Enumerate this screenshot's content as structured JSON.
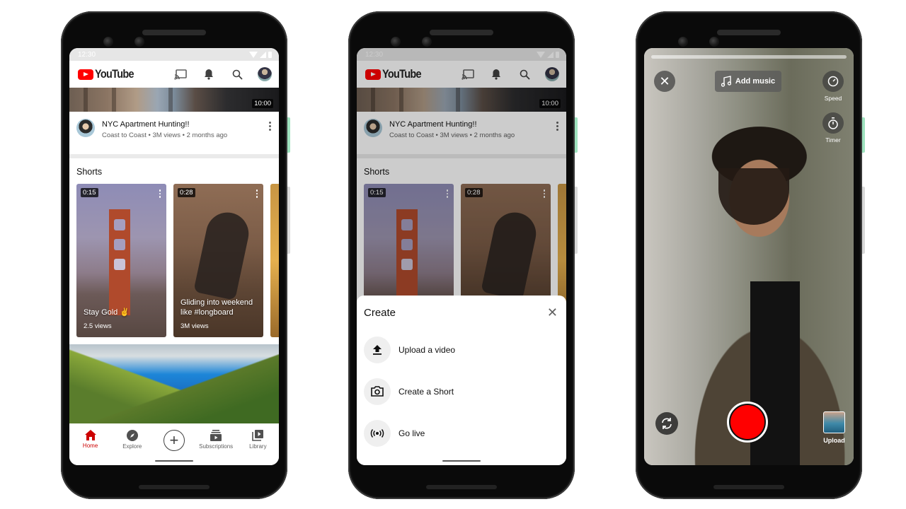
{
  "status_bar": {
    "time": "12:30"
  },
  "app": {
    "logo_text": "YouTube",
    "brand_color": "#ff0000",
    "header_icons": [
      "cast-icon",
      "bell-icon",
      "search-icon",
      "account-avatar"
    ]
  },
  "feed": {
    "video": {
      "duration": "10:00",
      "title": "NYC Apartment Hunting!!",
      "subtitle": "Coast to Coast • 3M views • 2 months ago"
    },
    "shorts_heading": "Shorts",
    "shorts": [
      {
        "duration": "0:15",
        "caption": "Stay Gold ✌",
        "views": "2.5 views"
      },
      {
        "duration": "0:28",
        "caption": "Gliding into weekend like #longboard",
        "views": "3M views"
      }
    ]
  },
  "bottom_nav": {
    "items": [
      {
        "label": "Home",
        "icon": "home-icon",
        "active": true
      },
      {
        "label": "Explore",
        "icon": "compass-icon",
        "active": false
      },
      {
        "label": "",
        "icon": "create-plus-icon",
        "active": false
      },
      {
        "label": "Subscriptions",
        "icon": "subscriptions-icon",
        "active": false
      },
      {
        "label": "Library",
        "icon": "library-icon",
        "active": false
      }
    ],
    "active_color": "#cc0000"
  },
  "create_sheet": {
    "title": "Create",
    "items": [
      {
        "label": "Upload a video",
        "icon": "upload-icon"
      },
      {
        "label": "Create a Short",
        "icon": "camera-icon"
      },
      {
        "label": "Go live",
        "icon": "live-broadcast-icon"
      }
    ]
  },
  "shorts_camera": {
    "add_music_label": "Add music",
    "speed_label": "Speed",
    "timer_label": "Timer",
    "upload_label": "Upload",
    "record_color": "#ff0000",
    "recording_progress": 0
  }
}
